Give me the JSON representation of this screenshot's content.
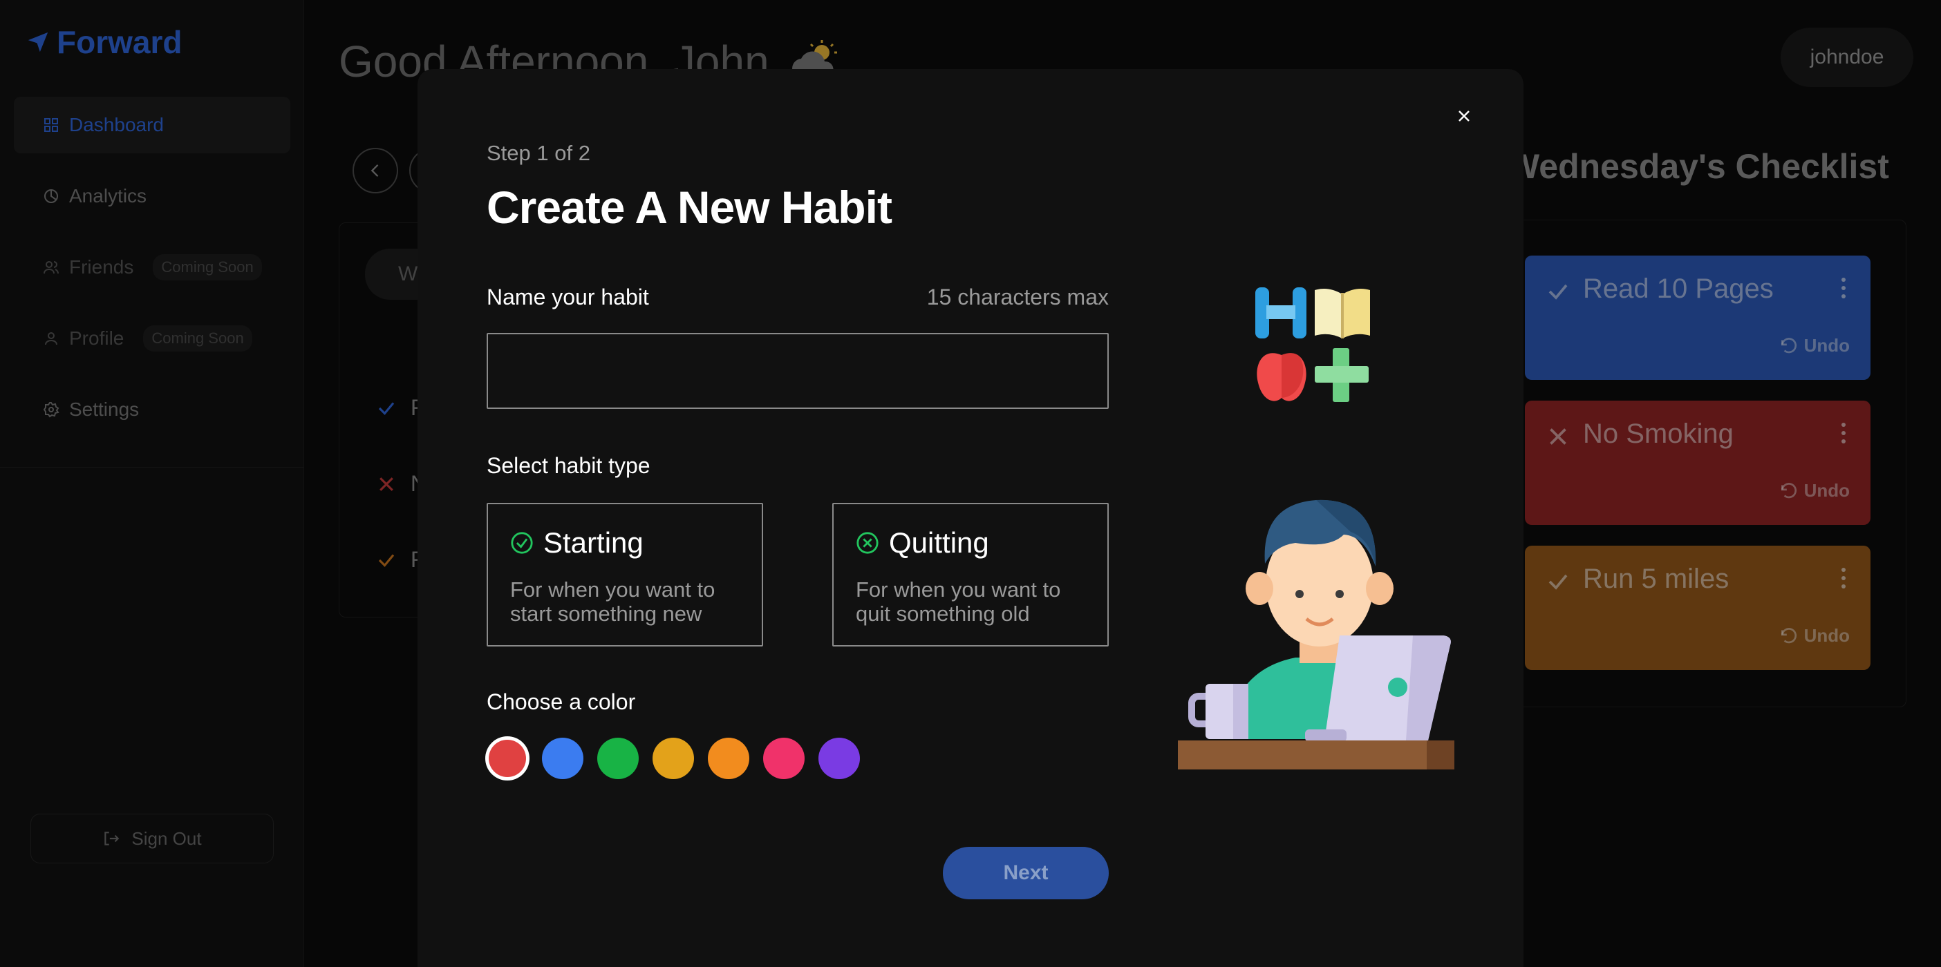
{
  "sidebar": {
    "logo": "Forward",
    "items": [
      {
        "label": "Dashboard",
        "active": true
      },
      {
        "label": "Analytics"
      },
      {
        "label": "Friends",
        "badge": "Coming Soon"
      },
      {
        "label": "Profile",
        "badge": "Coming Soon"
      },
      {
        "label": "Settings"
      }
    ],
    "signout": "Sign Out"
  },
  "header": {
    "greeting": "Good Afternoon, John",
    "username": "johndoe"
  },
  "background": {
    "tab_label": "W",
    "rows": [
      {
        "icon": "check-icon",
        "text": "R",
        "color": "#2f64d8"
      },
      {
        "icon": "x-icon",
        "text": "N",
        "color": "#c23a3a"
      },
      {
        "icon": "check-icon",
        "text": "R",
        "color": "#c8741e"
      }
    ],
    "checklist_title": "Wednesday's Checklist",
    "checklist": [
      {
        "name": "Read 10 Pages",
        "icon": "check-icon",
        "color": "#2b58b5",
        "undo": "Undo"
      },
      {
        "name": "No Smoking",
        "icon": "x-icon",
        "color": "#8f2424",
        "undo": "Undo"
      },
      {
        "name": "Run 5 miles",
        "icon": "check-icon",
        "color": "#92561a",
        "undo": "Undo"
      }
    ]
  },
  "modal": {
    "step": "Step 1 of 2",
    "title": "Create A New Habit",
    "name_label": "Name your habit",
    "name_hint": "15 characters max",
    "name_value": "",
    "type_label": "Select habit type",
    "types": [
      {
        "title": "Starting",
        "desc": "For when you want to start something new",
        "icon": "check-circle-icon"
      },
      {
        "title": "Quitting",
        "desc": "For when you want to quit something old",
        "icon": "x-circle-icon"
      }
    ],
    "color_label": "Choose a color",
    "colors": [
      "#e04141",
      "#3b7cf0",
      "#18b345",
      "#e3a21a",
      "#f28c1e",
      "#f0326a",
      "#7a3be3"
    ],
    "selected_color": "#e04141",
    "next": "Next"
  }
}
